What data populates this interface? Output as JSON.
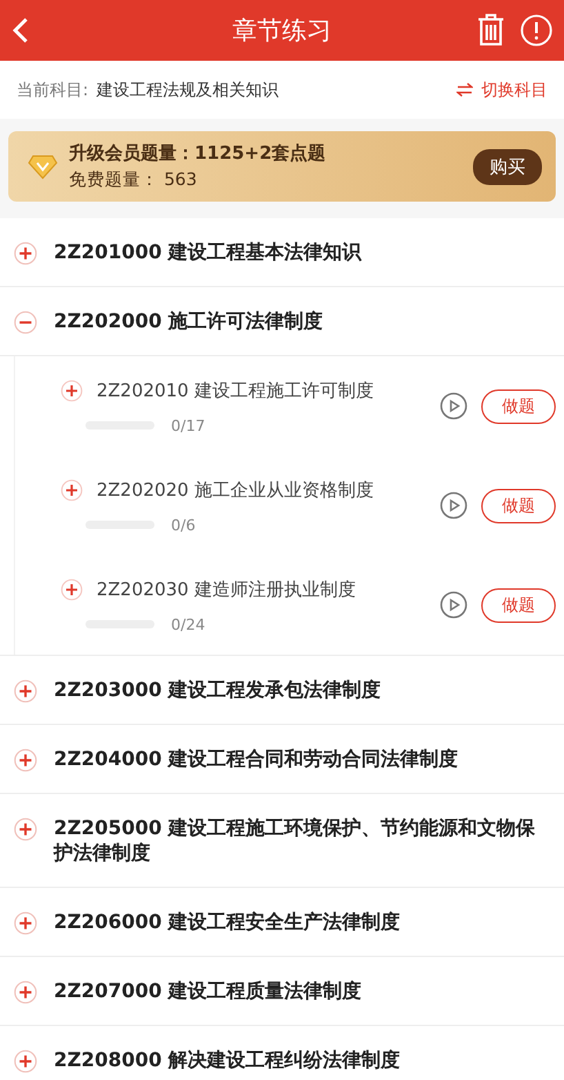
{
  "header": {
    "title": "章节练习"
  },
  "subject": {
    "label": "当前科目:",
    "value": "建设工程法规及相关知识",
    "switch": "切换科目"
  },
  "vip_banner": {
    "title": "升级会员题量：1125+2套点题",
    "free": "免费题量： 563",
    "button": "购买"
  },
  "chapters": [
    {
      "title": "2Z201000 建设工程基本法律知识",
      "expanded": false
    },
    {
      "title": "2Z202000 施工许可法律制度",
      "expanded": true,
      "children": [
        {
          "title": "2Z202010 建设工程施工许可制度",
          "count": "0/17",
          "button": "做题"
        },
        {
          "title": "2Z202020 施工企业从业资格制度",
          "count": "0/6",
          "button": "做题"
        },
        {
          "title": "2Z202030 建造师注册执业制度",
          "count": "0/24",
          "button": "做题"
        }
      ]
    },
    {
      "title": "2Z203000 建设工程发承包法律制度",
      "expanded": false
    },
    {
      "title": "2Z204000 建设工程合同和劳动合同法律制度",
      "expanded": false
    },
    {
      "title": "2Z205000 建设工程施工环境保护、节约能源和文物保护法律制度",
      "expanded": false
    },
    {
      "title": "2Z206000 建设工程安全生产法律制度",
      "expanded": false
    },
    {
      "title": "2Z207000 建设工程质量法律制度",
      "expanded": false
    },
    {
      "title": "2Z208000 解决建设工程纠纷法律制度",
      "expanded": false
    }
  ]
}
